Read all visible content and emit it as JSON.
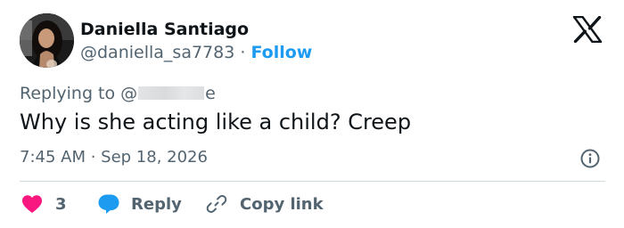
{
  "author": {
    "name": "Daniella Santiago",
    "handle": "@daniella_sa7783",
    "separator": " · ",
    "follow_label": "Follow"
  },
  "tweet": {
    "replying_prefix": "Replying to @",
    "replying_suffix": "e",
    "text": "Why is she acting like a child? Creep",
    "timestamp": "7:45 AM · Sep 18, 2026"
  },
  "actions": {
    "like_count": "3",
    "reply_label": "Reply",
    "copy_label": "Copy link"
  },
  "colors": {
    "like": "#f91880",
    "reply": "#1d9bf0",
    "link": "#1d9bf0",
    "secondary_text": "#536471"
  },
  "icons": [
    "x-logo-icon",
    "info-icon",
    "heart-icon",
    "reply-bubble-icon",
    "link-icon"
  ]
}
